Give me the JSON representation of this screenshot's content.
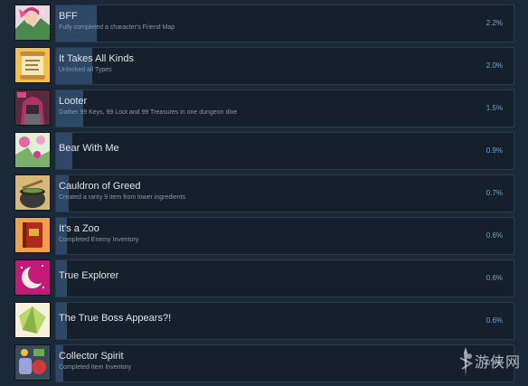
{
  "colors": {
    "background": "#1b2838",
    "bar_background": "#16202d",
    "bar_border": "#2a3b4e",
    "progress_fill": "#2c4866",
    "title_text": "#dfe3e6",
    "description_text": "#8a96a3",
    "percent_text": "#62a7e3"
  },
  "achievements": [
    {
      "title": "BFF",
      "description": "Fully completed a character's Friend Map",
      "percent": "2.2%",
      "progress": 0.022,
      "icon": "character-portrait-icon"
    },
    {
      "title": "It Takes All Kinds",
      "description": "Unlocked all Types",
      "percent": "2.0%",
      "progress": 0.02,
      "icon": "scroll-icon"
    },
    {
      "title": "Looter",
      "description": "Gather 99 Keys, 99 Loot and 99 Treasures in one dungeon dive",
      "percent": "1.5%",
      "progress": 0.015,
      "icon": "hooded-figure-icon"
    },
    {
      "title": "Bear With Me",
      "description": "",
      "percent": "0.9%",
      "progress": 0.009,
      "icon": "blossom-icon"
    },
    {
      "title": "Cauldron of Greed",
      "description": "Created a rarity 9 item from lower ingredients",
      "percent": "0.7%",
      "progress": 0.007,
      "icon": "cauldron-icon"
    },
    {
      "title": "It's a Zoo",
      "description": "Completed Enemy Inventory",
      "percent": "0.6%",
      "progress": 0.006,
      "icon": "book-icon"
    },
    {
      "title": "True Explorer",
      "description": "",
      "percent": "0.6%",
      "progress": 0.006,
      "icon": "crescent-moon-icon"
    },
    {
      "title": "The True Boss Appears?!",
      "description": "",
      "percent": "0.6%",
      "progress": 0.006,
      "icon": "gem-icon"
    },
    {
      "title": "Collector Spirit",
      "description": "Completed Item Inventory",
      "percent": "0.4%",
      "progress": 0.004,
      "icon": "item-collection-icon"
    }
  ],
  "watermark": {
    "text": "游侠网",
    "icon": "swordsman-watermark-icon"
  }
}
